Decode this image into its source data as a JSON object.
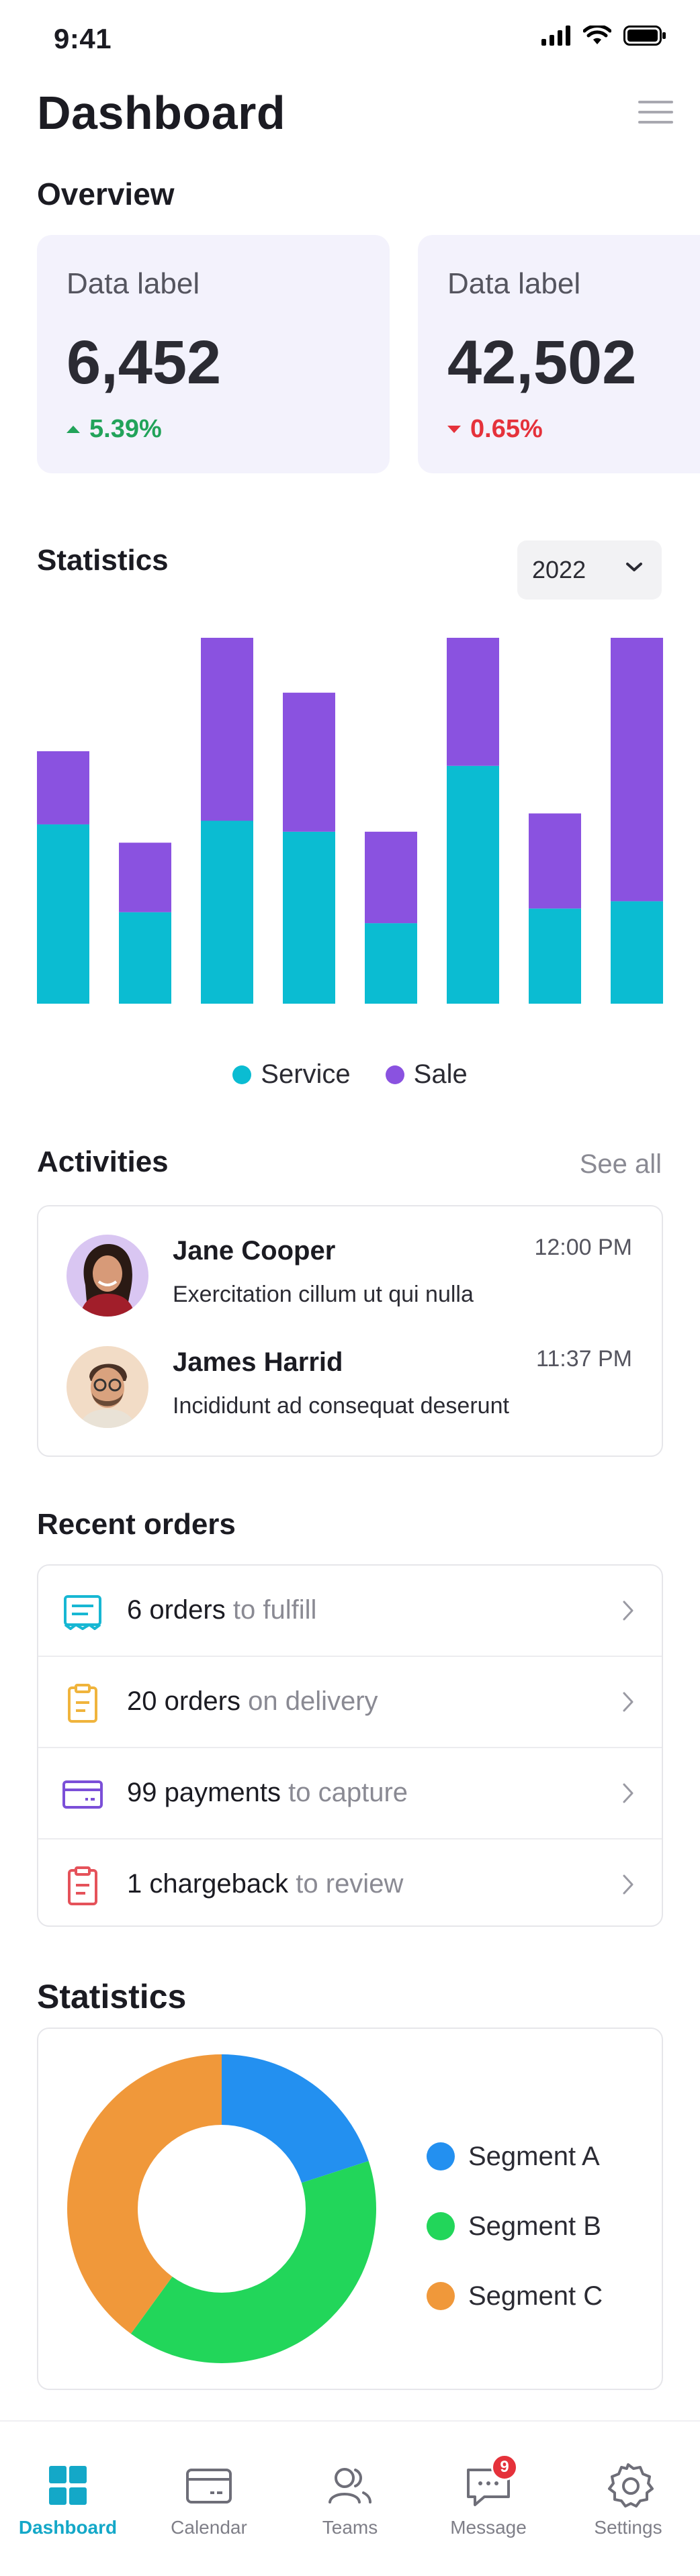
{
  "status_bar": {
    "time": "9:41"
  },
  "header": {
    "title": "Dashboard"
  },
  "overview": {
    "title": "Overview",
    "cards": [
      {
        "label": "Data label",
        "value": "6,452",
        "delta": "5.39%",
        "direction": "up",
        "delta_color": "#22a35a"
      },
      {
        "label": "Data label",
        "value": "42,502",
        "delta": "0.65%",
        "direction": "down",
        "delta_color": "#e5323b"
      }
    ]
  },
  "statistics": {
    "title": "Statistics",
    "year_selected": "2022",
    "legend": [
      {
        "name": "Service",
        "color": "#0bbcd2"
      },
      {
        "name": "Sale",
        "color": "#8a52e0"
      }
    ]
  },
  "chart_data": [
    {
      "type": "bar",
      "stacked": true,
      "categories": [
        "",
        "",
        "",
        "",
        "",
        "",
        "",
        ""
      ],
      "series": [
        {
          "name": "Service",
          "color": "#0bbcd2",
          "values": [
            49,
            25,
            50,
            47,
            22,
            65,
            26,
            28
          ]
        },
        {
          "name": "Sale",
          "color": "#8a52e0",
          "values": [
            20,
            19,
            50,
            38,
            25,
            35,
            26,
            72
          ]
        }
      ],
      "ylim": [
        0,
        100
      ],
      "grid": false,
      "legend": "bottom-center"
    },
    {
      "type": "pie",
      "donut": true,
      "categories": [
        "Segment A",
        "Segment B",
        "Segment C"
      ],
      "values": [
        20,
        40,
        40
      ],
      "colors": [
        "#2390f0",
        "#22d65a",
        "#f0983a"
      ],
      "legend": "right"
    }
  ],
  "activities": {
    "title": "Activities",
    "see_all": "See all",
    "items": [
      {
        "name": "Jane Cooper",
        "text": "Exercitation cillum ut qui nulla",
        "time": "12:00 PM"
      },
      {
        "name": "James Harrid",
        "text": "Incididunt ad consequat deserunt",
        "time": "11:37 PM"
      }
    ]
  },
  "recent_orders": {
    "title": "Recent orders",
    "items": [
      {
        "strong": "6 orders",
        "muted": " to fulfill",
        "icon": "receipt-icon",
        "color": "#17b7d3"
      },
      {
        "strong": "20 orders",
        "muted": " on delivery",
        "icon": "clipboard-icon",
        "color": "#f0b43c"
      },
      {
        "strong": "99 payments",
        "muted": " to capture",
        "icon": "credit-card-icon",
        "color": "#7b4fd8"
      },
      {
        "strong": "1 chargeback",
        "muted": " to review",
        "icon": "clipboard-icon",
        "color": "#e5525a"
      }
    ]
  },
  "segments": {
    "title": "Statistics",
    "items": [
      {
        "name": "Segment A",
        "color": "#2390f0"
      },
      {
        "name": "Segment B",
        "color": "#22d65a"
      },
      {
        "name": "Segment C",
        "color": "#f0983a"
      }
    ]
  },
  "tab_bar": {
    "tabs": [
      {
        "label": "Dashboard",
        "icon": "grid-icon",
        "active": true
      },
      {
        "label": "Calendar",
        "icon": "calendar-icon",
        "active": false
      },
      {
        "label": "Teams",
        "icon": "users-icon",
        "active": false
      },
      {
        "label": "Message",
        "icon": "message-icon",
        "active": false,
        "badge": "9"
      },
      {
        "label": "Settings",
        "icon": "gear-icon",
        "active": false
      }
    ]
  },
  "colors": {
    "accent": "#14a8c8",
    "card_bg": "#f3f2fc"
  }
}
